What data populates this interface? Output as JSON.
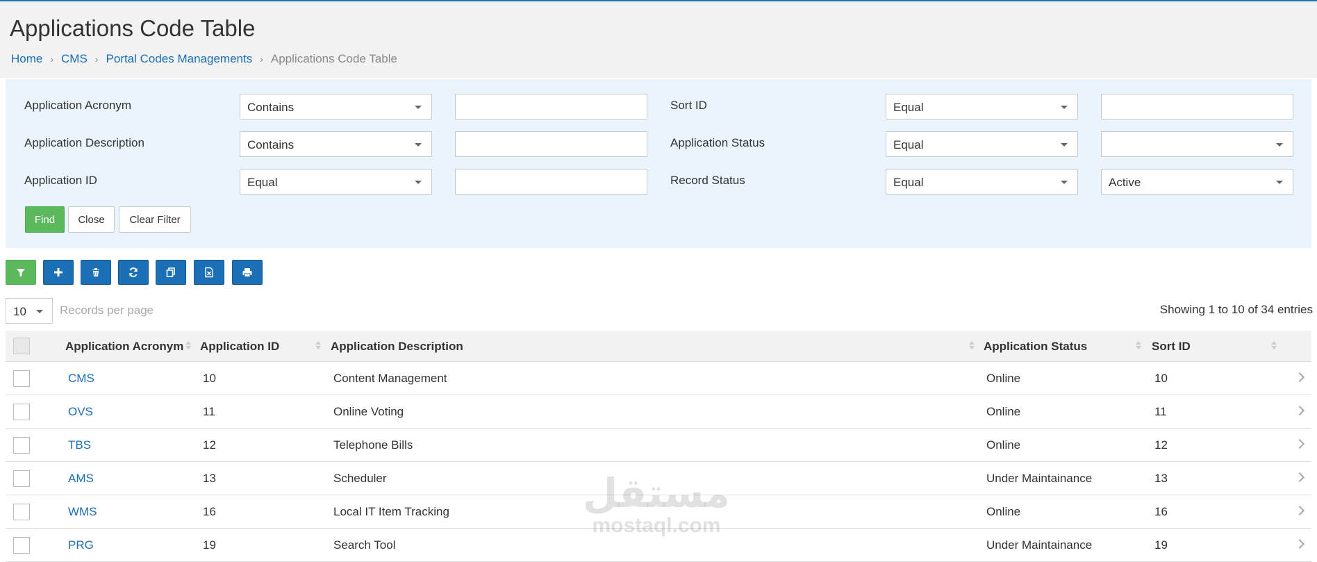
{
  "page": {
    "title": "Applications Code Table",
    "breadcrumb": [
      "Home",
      "CMS",
      "Portal Codes Managements",
      "Applications Code Table"
    ]
  },
  "filters": {
    "application_acronym": {
      "label": "Application Acronym",
      "operator": "Contains",
      "value": ""
    },
    "application_description": {
      "label": "Application Description",
      "operator": "Contains",
      "value": ""
    },
    "application_id": {
      "label": "Application ID",
      "operator": "Equal",
      "value": ""
    },
    "sort_id": {
      "label": "Sort ID",
      "operator": "Equal",
      "value": ""
    },
    "application_status": {
      "label": "Application Status",
      "operator": "Equal",
      "value": ""
    },
    "record_status": {
      "label": "Record Status",
      "operator": "Equal",
      "value": "Active"
    },
    "buttons": {
      "find": "Find",
      "close": "Close",
      "clear": "Clear Filter"
    }
  },
  "toolbar": {
    "buttons": [
      "filter-icon",
      "plus-icon",
      "trash-icon",
      "refresh-icon",
      "copy-icon",
      "excel-icon",
      "print-icon"
    ],
    "colors": {
      "primary": "#1a6fb5",
      "success": "#5cb85c"
    }
  },
  "pagination": {
    "per_page": "10",
    "per_page_label": "Records per page",
    "info": "Showing 1 to 10 of 34 entries"
  },
  "table": {
    "columns": [
      "Application Acronym",
      "Application ID",
      "Application Description",
      "Application Status",
      "Sort ID"
    ],
    "rows": [
      {
        "acronym": "CMS",
        "id": "10",
        "description": "Content Management",
        "status": "Online",
        "sort_id": "10"
      },
      {
        "acronym": "OVS",
        "id": "11",
        "description": "Online Voting",
        "status": "Online",
        "sort_id": "11"
      },
      {
        "acronym": "TBS",
        "id": "12",
        "description": "Telephone Bills",
        "status": "Online",
        "sort_id": "12"
      },
      {
        "acronym": "AMS",
        "id": "13",
        "description": "Scheduler",
        "status": "Under Maintainance",
        "sort_id": "13"
      },
      {
        "acronym": "WMS",
        "id": "16",
        "description": "Local IT Item Tracking",
        "status": "Online",
        "sort_id": "16"
      },
      {
        "acronym": "PRG",
        "id": "19",
        "description": "Search Tool",
        "status": "Under Maintainance",
        "sort_id": "19"
      }
    ]
  },
  "watermark": {
    "arabic": "مستقل",
    "latin": "mostaql.com"
  }
}
